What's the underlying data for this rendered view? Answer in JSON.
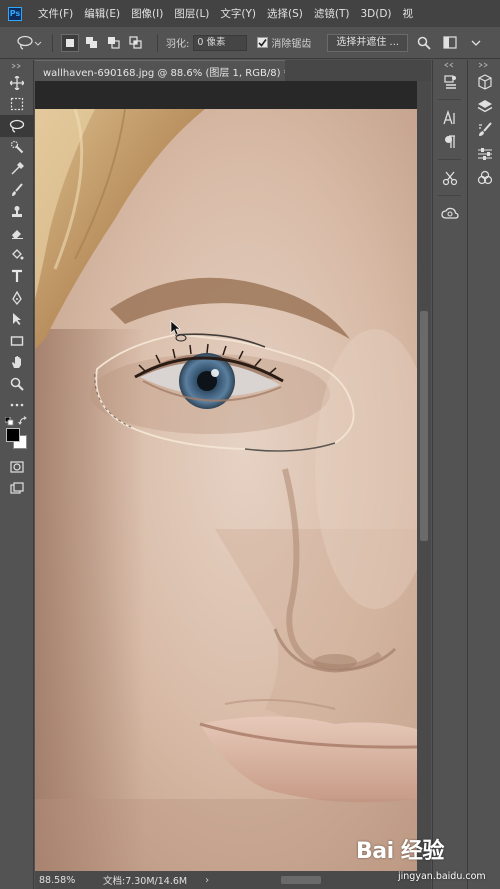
{
  "app": {
    "logo_text": "Ps"
  },
  "menu": [
    {
      "label": "文件(F)"
    },
    {
      "label": "编辑(E)"
    },
    {
      "label": "图像(I)"
    },
    {
      "label": "图层(L)"
    },
    {
      "label": "文字(Y)"
    },
    {
      "label": "选择(S)"
    },
    {
      "label": "滤镜(T)"
    },
    {
      "label": "3D(D)"
    },
    {
      "label": "视"
    }
  ],
  "options": {
    "feather_label": "羽化:",
    "feather_value": "0 像素",
    "antialias_label": "消除锯齿",
    "antialias_checked": true,
    "select_mask_label": "选择并遮住 ..."
  },
  "document": {
    "tab_title": "wallhaven-690168.jpg @ 88.6% (图层 1, RGB/8) *",
    "close": "×"
  },
  "status": {
    "zoom": "88.58%",
    "doc_info": "文档:7.30M/14.6M",
    "arrow": "›"
  },
  "tools": [
    {
      "name": "move-tool",
      "icon": "move-icon"
    },
    {
      "name": "marquee-tool",
      "icon": "rect-marquee-icon"
    },
    {
      "name": "lasso-tool",
      "icon": "lasso-icon",
      "active": true
    },
    {
      "name": "quick-select-tool",
      "icon": "quick-select-icon"
    },
    {
      "name": "eyedropper-tool",
      "icon": "eyedropper-icon"
    },
    {
      "name": "brush-tool",
      "icon": "brush-icon"
    },
    {
      "name": "stamp-tool",
      "icon": "stamp-icon"
    },
    {
      "name": "eraser-tool",
      "icon": "eraser-icon"
    },
    {
      "name": "paint-bucket-tool",
      "icon": "bucket-icon"
    },
    {
      "name": "type-tool",
      "icon": "type-icon"
    },
    {
      "name": "pen-tool",
      "icon": "pen-icon"
    },
    {
      "name": "path-select-tool",
      "icon": "arrow-select-icon"
    },
    {
      "name": "shape-tool",
      "icon": "rectangle-shape-icon"
    },
    {
      "name": "hand-tool",
      "icon": "hand-icon"
    },
    {
      "name": "zoom-tool",
      "icon": "zoom-icon"
    },
    {
      "name": "more-tools",
      "icon": "ellipsis-icon"
    }
  ],
  "colors": {
    "foreground": "#000000",
    "background": "#ffffff",
    "ui_dark": "#535353",
    "menubar": "#434343",
    "canvas_bg": "#282828"
  },
  "watermark": {
    "brand": "Bai 经验",
    "url": "jingyan.baidu.com"
  }
}
